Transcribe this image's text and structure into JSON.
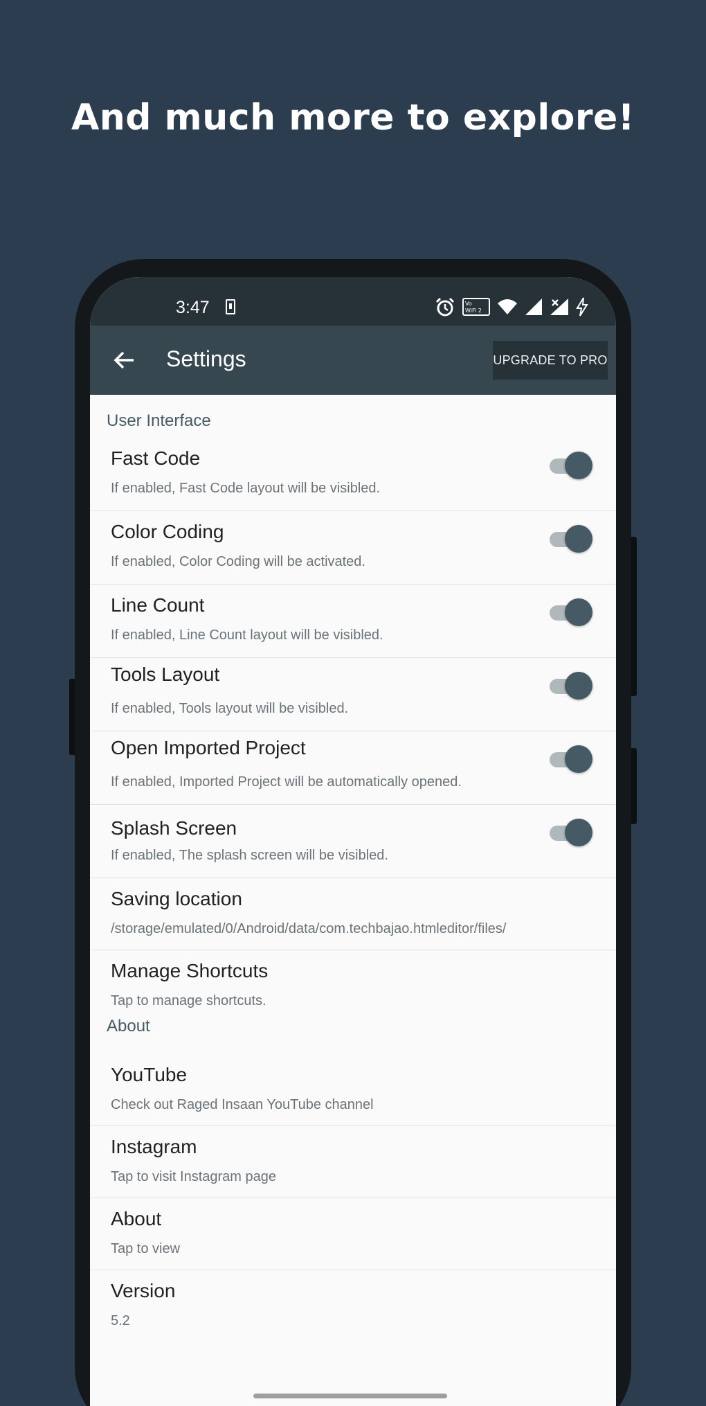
{
  "headline": "And much more to explore!",
  "status_bar": {
    "time": "3:47",
    "icons": [
      "screenshot-icon",
      "alarm-icon",
      "volte-icon",
      "wifi-icon",
      "signal-icon",
      "signal-x-icon",
      "charging-icon"
    ],
    "volte_label": "Vo WiFi 2"
  },
  "app_bar": {
    "title": "Settings",
    "back_icon": "arrow-back-icon",
    "upgrade_label": "UPGRADE TO PRO",
    "background": "#37474f",
    "status_background": "#263238"
  },
  "sections": {
    "user_interface": {
      "title": "User Interface",
      "items": [
        {
          "title": "Fast Code",
          "summary": "If enabled, Fast Code layout will be visibled.",
          "toggle": true
        },
        {
          "title": "Color Coding",
          "summary": "If enabled, Color Coding will be activated.",
          "toggle": true
        },
        {
          "title": "Line Count",
          "summary": "If enabled, Line Count layout will be visibled.",
          "toggle": true
        },
        {
          "title": "Tools Layout",
          "summary": "If enabled, Tools layout will be visibled.",
          "toggle": true
        },
        {
          "title": "Open Imported Project",
          "summary": "If enabled, Imported Project will be automatically opened.",
          "toggle": true
        },
        {
          "title": "Splash Screen",
          "summary": "If enabled, The splash screen will be visibled.",
          "toggle": true
        },
        {
          "title": "Saving location",
          "summary": "/storage/emulated/0/Android/data/com.techbajao.htmleditor/files/"
        },
        {
          "title": "Manage Shortcuts",
          "summary": "Tap to manage shortcuts."
        }
      ]
    },
    "about": {
      "title": "About",
      "items": [
        {
          "title": "YouTube",
          "summary": "Check out Raged Insaan YouTube channel"
        },
        {
          "title": "Instagram",
          "summary": "Tap to visit Instagram page"
        },
        {
          "title": "About",
          "summary": "Tap to view"
        },
        {
          "title": "Version",
          "summary": "5.2"
        }
      ]
    }
  },
  "colors": {
    "page_background": "#2d3d50",
    "accent": "#455a64",
    "screen_background": "#fafafa"
  }
}
